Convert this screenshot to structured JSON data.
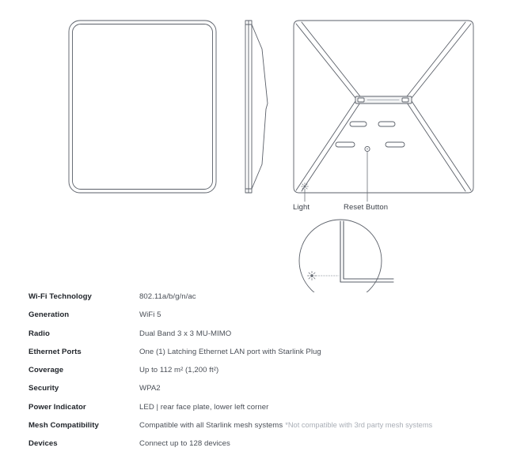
{
  "diagram": {
    "views": {
      "front": "front-face-plate-view",
      "side": "side-profile-view",
      "rear": "rear-face-plate-view",
      "detail": "magnified-light-corner-detail"
    },
    "callouts": [
      {
        "id": "light",
        "label": "Light",
        "icon": "light-indicator-icon"
      },
      {
        "id": "reset",
        "label": "Reset Button",
        "icon": "reset-button-icon"
      }
    ],
    "stroke_color": "#5a5f68",
    "fill_color": "#ffffff"
  },
  "specs": {
    "rows": [
      {
        "label": "Wi-Fi Technology",
        "value": "802.11a/b/g/n/ac",
        "note": ""
      },
      {
        "label": "Generation",
        "value": "WiFi 5",
        "note": ""
      },
      {
        "label": "Radio",
        "value": "Dual Band 3 x 3 MU-MIMO",
        "note": ""
      },
      {
        "label": "Ethernet Ports",
        "value": "One (1) Latching Ethernet LAN port with Starlink Plug",
        "note": ""
      },
      {
        "label": "Coverage",
        "value": "Up to 112 m² (1,200 ft²)",
        "note": ""
      },
      {
        "label": "Security",
        "value": "WPA2",
        "note": ""
      },
      {
        "label": "Power Indicator",
        "value": "LED | rear face plate, lower left corner",
        "note": ""
      },
      {
        "label": "Mesh Compatibility",
        "value": "Compatible with all Starlink mesh systems",
        "note": "*Not compatible with 3rd party mesh systems"
      },
      {
        "label": "Devices",
        "value": "Connect up to 128 devices",
        "note": ""
      }
    ]
  },
  "colors": {
    "background": "#ffffff",
    "label_text": "#21252b",
    "value_text": "#4a4f57",
    "note_text": "#a9aeb6",
    "line": "#5a5f68"
  }
}
